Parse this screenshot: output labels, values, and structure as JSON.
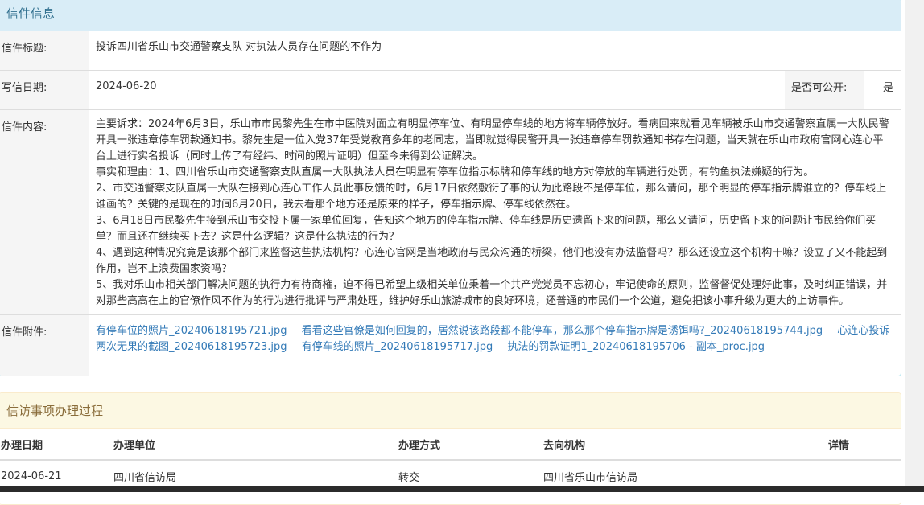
{
  "letter_panel": {
    "heading": "信件信息",
    "title_label": "信件标题:",
    "title_value": "投诉四川省乐山市交通警察支队 对执法人员存在问题的不作为",
    "date_label": "写信日期:",
    "date_value": "2024-06-20",
    "public_label": "是否可公开:",
    "public_value": "是",
    "content_label": "信件内容:",
    "content_paragraphs": [
      "主要诉求：2024年6月3日，乐山市市民黎先生在市中医院对面立有明显停车位、有明显停车线的地方将车辆停放好。看病回来就看见车辆被乐山市交通警察直属一大队民警开具一张违章停车罚款通知书。黎先生是一位入党37年受党教育多年的老同志，当即就觉得民警开具一张违章停车罚款通知书存在问题，当天就在乐山市政府官网心连心平台上进行实名投诉（同时上传了有经纬、时间的照片证明）但至今未得到公证解决。",
      "事实和理由：1、四川省乐山市交通警察支队直属一大队执法人员在明显有停车位指示标牌和停车线的地方对停放的车辆进行处罚，有钓鱼执法嫌疑的行为。",
      "2、市交通警察支队直属一大队在接到心连心工作人员此事反馈的时，6月17日依然敷衍了事的认为此路段不是停车位，那么请问，那个明显的停车指示牌谁立的？停车线上谁画的？关键的是现在的时间6月20日，我去看那个地方还是原来的样子，停车指示牌、停车线依然在。",
      "3、6月18日市民黎先生接到乐山市交投下属一家单位回复，告知这个地方的停车指示牌、停车线是历史遗留下来的问题，那么又请问，历史留下来的问题让市民给你们买单？而且还在继续买下去？这是什么逻辑？这是什么执法的行为？",
      "4、遇到这种情况究竟是该那个部门来监督这些执法机构？心连心官网是当地政府与民众沟通的桥梁，他们也没有办法监督吗？那么还设立这个机构干嘛？设立了又不能起到作用，岂不上浪费国家资吗？",
      "5、我对乐山市相关部门解决问题的执行力有待商榷，迫不得已希望上级相关单位秉着一个共产党党员不忘初心，牢记使命的原则，监督督促处理好此事，及时纠正错误，并对那些高高在上的官僚作风不作为的行为进行批评与严肃处理，维护好乐山旅游城市的良好环境，还普通的市民们一个公道，避免把该小事升级为更大的上访事件。"
    ],
    "attachment_label": "信件附件:",
    "attachments": [
      "有停车位的照片_20240618195721.jpg",
      "看看这些官僚是如何回复的，居然说该路段都不能停车，那么那个停车指示牌是诱饵吗?_20240618195744.jpg",
      "心连心投诉两次无果的截图_20240618195723.jpg",
      "有停车线的照片_20240618195717.jpg",
      "执法的罚款证明1_20240618195706 - 副本_proc.jpg"
    ]
  },
  "process_panel": {
    "heading": "信访事项办理过程",
    "columns": [
      "办理日期",
      "办理单位",
      "办理方式",
      "去向机构",
      "详情"
    ],
    "rows": [
      [
        "2024-06-21",
        "四川省信访局",
        "转交",
        "四川省乐山市信访局",
        ""
      ]
    ]
  },
  "colors": {
    "info_header_bg": "#d9edf7",
    "info_header_text": "#31708f",
    "process_header_bg": "#fcf8e3",
    "process_header_text": "#8a6d3b",
    "link": "#337ab7"
  }
}
